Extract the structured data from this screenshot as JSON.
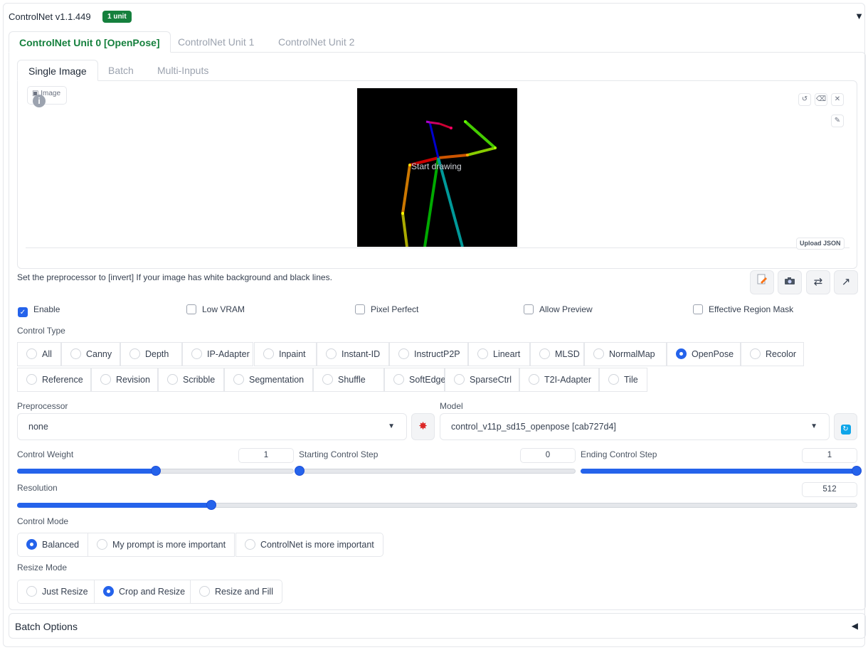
{
  "header": {
    "title": "ControlNet v1.1.449",
    "badge": "1 unit",
    "collapse_icon": "triangle-down-icon"
  },
  "unit_tabs": [
    "ControlNet Unit 0 [OpenPose]",
    "ControlNet Unit 1",
    "ControlNet Unit 2"
  ],
  "input_tabs": [
    "Single Image",
    "Batch",
    "Multi-Inputs"
  ],
  "image_panel": {
    "label": "Image",
    "canvas_hint": "Start drawing",
    "upload_json": "Upload JSON",
    "buttons": [
      "undo-icon",
      "eraser-icon",
      "close-icon",
      "brush-icon"
    ]
  },
  "hint_text": "Set the preprocessor to [invert] If your image has white background and black lines.",
  "tool_buttons": [
    "edit-icon",
    "camera-icon",
    "swap-icon",
    "send-icon"
  ],
  "checkboxes": [
    {
      "label": "Enable",
      "checked": true
    },
    {
      "label": "Low VRAM",
      "checked": false
    },
    {
      "label": "Pixel Perfect",
      "checked": false
    },
    {
      "label": "Allow Preview",
      "checked": false
    },
    {
      "label": "Effective Region Mask",
      "checked": false
    }
  ],
  "control_type": {
    "label": "Control Type",
    "selected": "OpenPose",
    "options": [
      "All",
      "Canny",
      "Depth",
      "IP-Adapter",
      "Inpaint",
      "Instant-ID",
      "InstructP2P",
      "Lineart",
      "MLSD",
      "NormalMap",
      "OpenPose",
      "Recolor",
      "Reference",
      "Revision",
      "Scribble",
      "Segmentation",
      "Shuffle",
      "SoftEdge",
      "SparseCtrl",
      "T2I-Adapter",
      "Tile"
    ]
  },
  "preprocessor": {
    "label": "Preprocessor",
    "value": "none",
    "run_icon": "explosion-icon"
  },
  "model": {
    "label": "Model",
    "value": "control_v11p_sd15_openpose [cab727d4]",
    "refresh_icon": "refresh-icon"
  },
  "sliders": {
    "control_weight": {
      "label": "Control Weight",
      "value": "1",
      "fraction": 0.5
    },
    "starting_step": {
      "label": "Starting Control Step",
      "value": "0",
      "fraction": 0.0
    },
    "ending_step": {
      "label": "Ending Control Step",
      "value": "1",
      "fraction": 1.0
    },
    "resolution": {
      "label": "Resolution",
      "value": "512",
      "fraction": 0.231
    }
  },
  "control_mode": {
    "label": "Control Mode",
    "selected": "Balanced",
    "options": [
      "Balanced",
      "My prompt is more important",
      "ControlNet is more important"
    ]
  },
  "resize_mode": {
    "label": "Resize Mode",
    "selected": "Crop and Resize",
    "options": [
      "Just Resize",
      "Crop and Resize",
      "Resize and Fill"
    ]
  },
  "batch_options": {
    "title": "Batch Options",
    "expand_icon": "triangle-left-icon"
  },
  "colors": {
    "accent": "#2563eb",
    "tab_active": "#15803d",
    "badge_bg": "#15803d"
  }
}
